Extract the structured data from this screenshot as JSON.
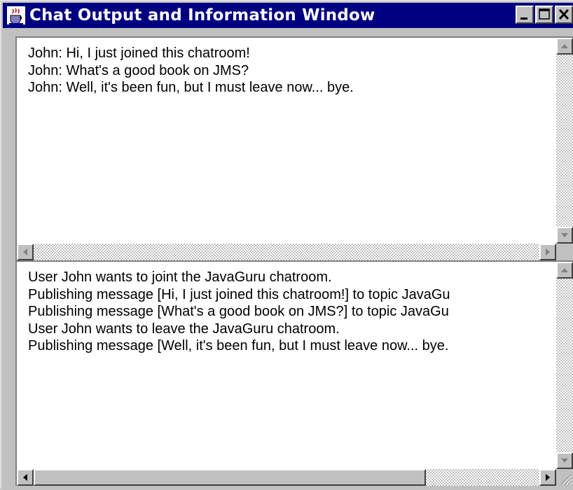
{
  "window": {
    "title": "Chat Output and Information Window",
    "title_bar_color": "#000080",
    "app_icon": "java-coffee-cup-icon",
    "controls": {
      "minimize_icon": "minimize-icon",
      "maximize_icon": "maximize-icon",
      "close_icon": "close-icon"
    }
  },
  "chat_output": {
    "lines": [
      "John: Hi, I just joined this chatroom!",
      "John: What's a good book on JMS?",
      "John: Well, it's been fun, but I must leave now... bye."
    ]
  },
  "info_output": {
    "lines": [
      "User John wants to joint the JavaGuru chatroom.",
      "Publishing message [Hi, I just joined this chatroom!] to topic JavaGu",
      "Publishing message [What's a good book on JMS?] to topic JavaGu",
      "User John wants to leave the JavaGuru chatroom.",
      "Publishing message [Well, it's been fun, but I must leave now... bye."
    ]
  },
  "scrollbars": {
    "up_icon": "arrow-up-icon",
    "down_icon": "arrow-down-icon",
    "left_icon": "arrow-left-icon",
    "right_icon": "arrow-right-icon"
  }
}
